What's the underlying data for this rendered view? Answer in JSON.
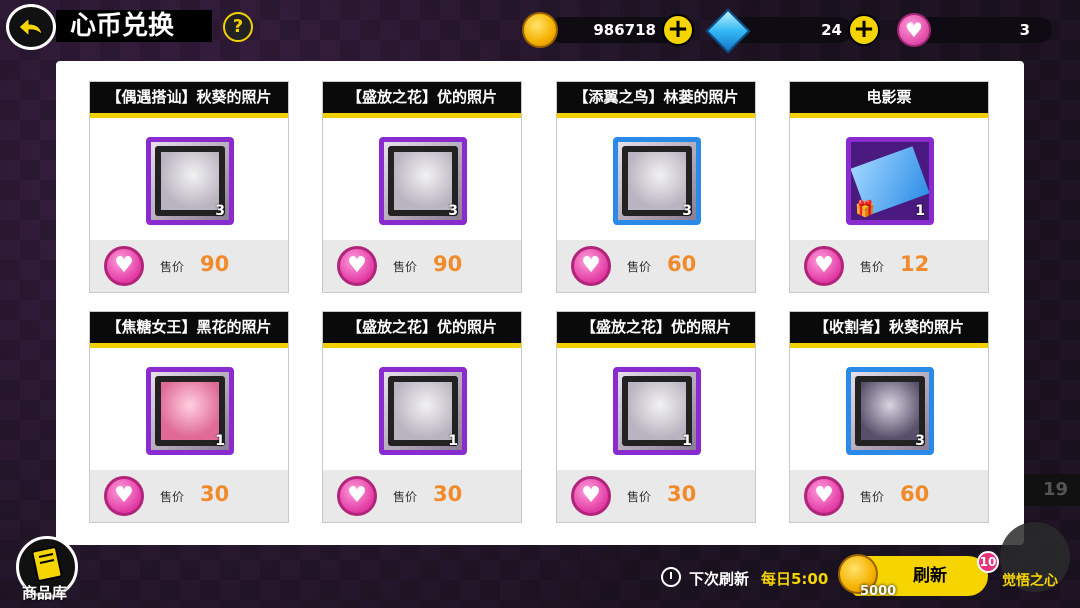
{
  "header": {
    "title": "心币兑换",
    "help": "?",
    "currencies": [
      {
        "icon": "gold-coin-icon",
        "value": "986718"
      },
      {
        "icon": "blue-gem-icon",
        "value": "24"
      },
      {
        "icon": "heart-coin-icon",
        "value": "3"
      }
    ],
    "plus": "+"
  },
  "cards": [
    {
      "title": "【偶遇搭讪】秋葵的照片",
      "count": "3",
      "frame": "purple",
      "price_label": "售价",
      "price": "90"
    },
    {
      "title": "【盛放之花】优的照片",
      "count": "3",
      "frame": "purple",
      "price_label": "售价",
      "price": "90"
    },
    {
      "title": "【添翼之鸟】林蒌的照片",
      "count": "3",
      "frame": "blue",
      "price_label": "售价",
      "price": "60"
    },
    {
      "title": "电影票",
      "count": "1",
      "frame": "purple",
      "price_label": "售价",
      "price": "12"
    },
    {
      "title": "【焦糖女王】黑花的照片",
      "count": "1",
      "frame": "purple",
      "price_label": "售价",
      "price": "30"
    },
    {
      "title": "【盛放之花】优的照片",
      "count": "1",
      "frame": "purple",
      "price_label": "售价",
      "price": "30"
    },
    {
      "title": "【盛放之花】优的照片",
      "count": "1",
      "frame": "purple",
      "price_label": "售价",
      "price": "30"
    },
    {
      "title": "【收割者】秋葵的照片",
      "count": "3",
      "frame": "blue",
      "price_label": "售价",
      "price": "60"
    }
  ],
  "footer": {
    "shop_label": "商品库",
    "next_refresh_label": "下次刷新",
    "next_refresh_time": "每日5:00",
    "refresh_label": "刷新",
    "refresh_cost": "5000",
    "refresh_badge": "10",
    "awaken_label": "觉悟之心",
    "side_number": "19"
  },
  "colors": {
    "accent": "#f5d400",
    "purple_frame": "#8a2bd0",
    "blue_frame": "#2a8ae8",
    "price": "#f08a2a"
  }
}
